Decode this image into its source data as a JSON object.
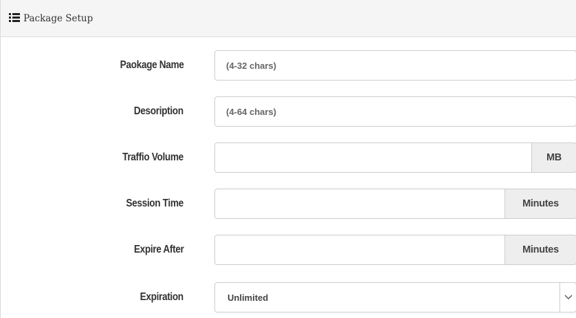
{
  "panel": {
    "title": "Package Setup",
    "icon": "list-icon"
  },
  "form": {
    "package_name": {
      "label": "Paokage Name",
      "placeholder": "(4-32 chars)",
      "value": ""
    },
    "description": {
      "label": "Desoription",
      "placeholder": "(4-64 chars)",
      "value": ""
    },
    "traffic_volume": {
      "label": "Traffio Volume",
      "value": "",
      "unit": "MB"
    },
    "session_time": {
      "label": "Session Time",
      "value": "",
      "unit": "Minutes"
    },
    "expire_after": {
      "label": "Expire After",
      "value": "",
      "unit": "Minutes"
    },
    "expiration": {
      "label": "Expiration",
      "selected": "Unlimited",
      "icon": "chevron-down-icon"
    }
  }
}
